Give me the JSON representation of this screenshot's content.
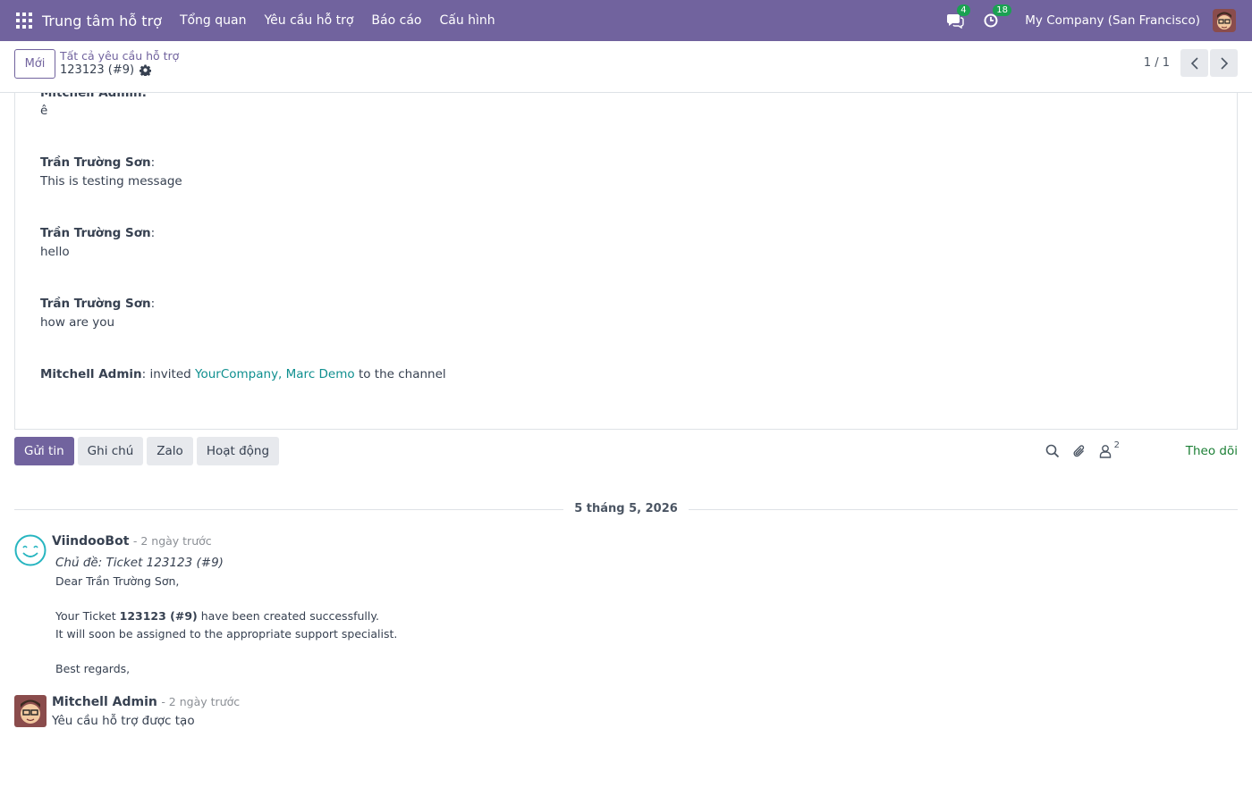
{
  "navbar": {
    "app_title": "Trung tâm hỗ trợ",
    "menu": [
      "Tổng quan",
      "Yêu cầu hỗ trợ",
      "Báo cáo",
      "Cấu hình"
    ],
    "messages_badge": "4",
    "activities_badge": "18",
    "company": "My Company (San Francisco)"
  },
  "control_panel": {
    "new_button": "Mới",
    "breadcrumb": "Tất cả yêu cầu hỗ trợ",
    "record_name": "123123 (#9)",
    "pager": "1 / 1"
  },
  "conversation": {
    "partial_author": "Mitchell Admin:",
    "partial_text": "ê",
    "items": [
      {
        "author": "Trần Trường Sơn",
        "text": "This is testing message"
      },
      {
        "author": "Trần Trường Sơn",
        "text": "hello"
      },
      {
        "author": "Trần Trường Sơn",
        "text": "how are you"
      }
    ],
    "invite": {
      "author": "Mitchell Admin",
      "pre": "invited",
      "link": "YourCompany, Marc Demo",
      "post": "to the channel"
    }
  },
  "chatter": {
    "buttons": [
      "Gửi tin",
      "Ghi chú",
      "Zalo",
      "Hoạt động"
    ],
    "followers_count": "2",
    "follow_label": "Theo dõi",
    "date_separator": "5 tháng 5, 2026",
    "messages": [
      {
        "author": "ViindooBot",
        "time": "- 2 ngày trước",
        "subject": "Chủ đề: Ticket 123123 (#9)",
        "greeting": "Dear Trần Trường Sơn,",
        "line1_pre": "Your Ticket",
        "line1_bold": "123123 (#9)",
        "line1_post": "have been created successfully.",
        "line2": "It will soon be assigned to the appropriate support specialist.",
        "closing": "Best regards,"
      },
      {
        "author": "Mitchell Admin",
        "time": "- 2 ngày trước",
        "body": "Yêu cầu hỗ trợ được tạo"
      }
    ]
  },
  "colors": {
    "brand": "#71639e",
    "link": "#0f8f8f",
    "follow": "#1b7f35",
    "badge": "#1aa152"
  }
}
